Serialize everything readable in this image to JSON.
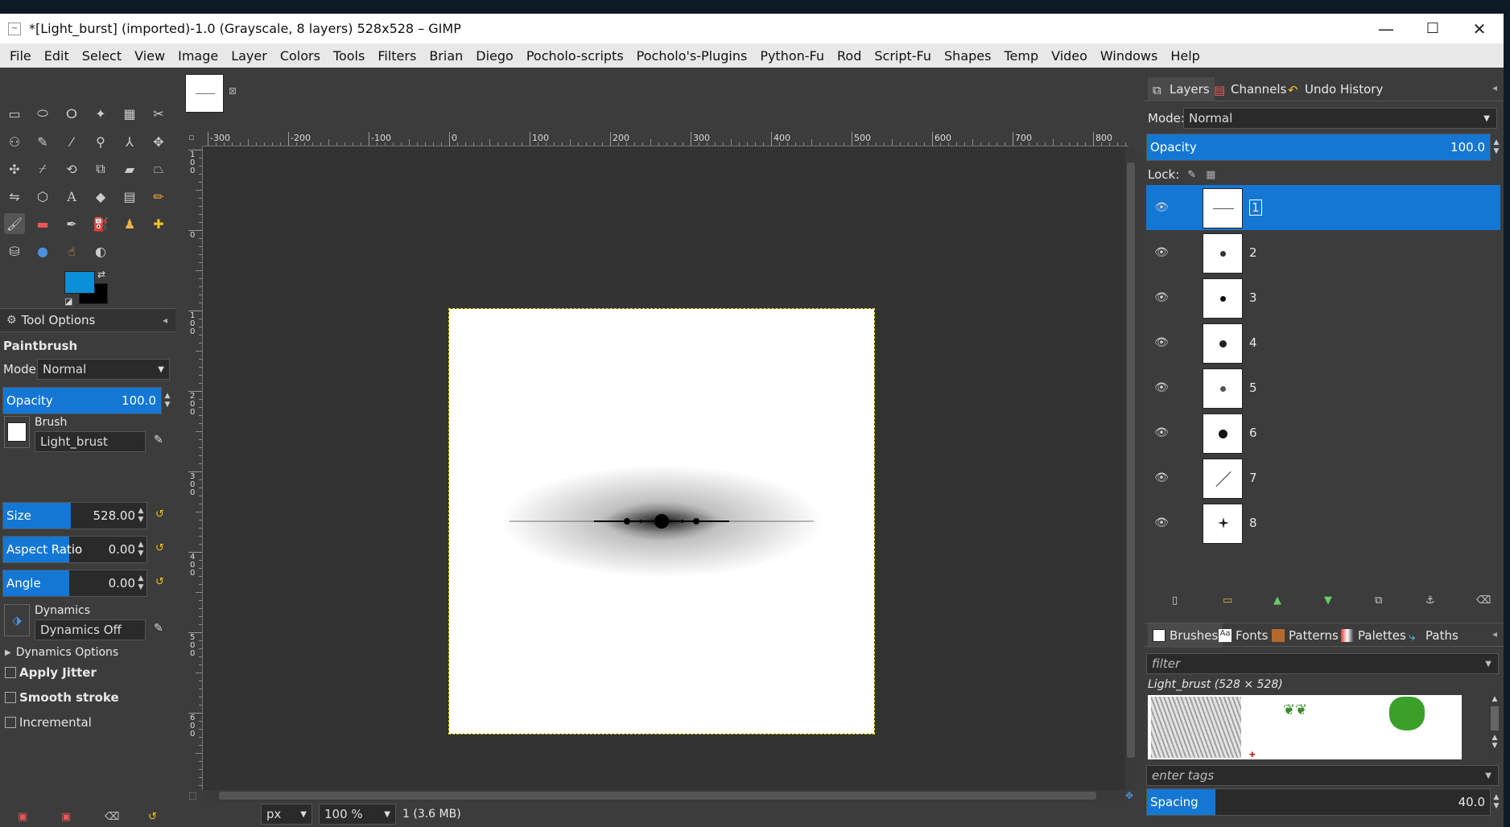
{
  "window": {
    "title": "*[Light_burst] (imported)-1.0 (Grayscale, 8 layers) 528x528 – GIMP",
    "minimize": "—",
    "maximize": "☐",
    "close": "✕"
  },
  "menu": [
    "File",
    "Edit",
    "Select",
    "View",
    "Image",
    "Layer",
    "Colors",
    "Tools",
    "Filters",
    "Brian",
    "Diego",
    "Pocholo-scripts",
    "Pocholo's-Plugins",
    "Python-Fu",
    "Rod",
    "Script-Fu",
    "Shapes",
    "Temp",
    "Video",
    "Windows",
    "Help"
  ],
  "colors": {
    "fg": "#0b8fd6",
    "bg": "#000000",
    "accent": "#1477d4"
  },
  "tool_options": {
    "tab_label": "Tool Options",
    "tool_name": "Paintbrush",
    "mode_label": "Mode:",
    "mode_value": "Normal",
    "opacity_label": "Opacity",
    "opacity_value": "100.0",
    "brush_label": "Brush",
    "brush_value": "Light_brust",
    "size_label": "Size",
    "size_value": "528.00",
    "aspect_label": "Aspect Ratio",
    "aspect_value": "0.00",
    "angle_label": "Angle",
    "angle_value": "0.00",
    "dynamics_label": "Dynamics",
    "dynamics_value": "Dynamics Off",
    "dynamics_options": "Dynamics Options",
    "apply_jitter": "Apply Jitter",
    "smooth_stroke": "Smooth stroke",
    "incremental": "Incremental"
  },
  "ruler": {
    "labels": [
      "-300",
      "-200",
      "-100",
      "0",
      "100",
      "200",
      "300",
      "400",
      "500",
      "600",
      "700",
      "800"
    ]
  },
  "vruler": {
    "labels": [
      "100",
      "0",
      "100",
      "200",
      "300",
      "400",
      "500",
      "600"
    ]
  },
  "status": {
    "unit": "px",
    "zoom": "100 %",
    "info": "1 (3.6 MB)"
  },
  "layers_dock": {
    "tabs": [
      "Layers",
      "Channels",
      "Undo History"
    ],
    "mode_label": "Mode:",
    "mode_value": "Normal",
    "opacity_label": "Opacity",
    "opacity_value": "100.0",
    "lock_label": "Lock:",
    "layers": [
      "1",
      "2",
      "3",
      "4",
      "5",
      "6",
      "7",
      "8"
    ],
    "selected_index": 0
  },
  "brushes_dock": {
    "tabs": [
      "Brushes",
      "Fonts",
      "Patterns",
      "Palettes",
      "Paths"
    ],
    "filter_placeholder": "filter",
    "brush_info": "Light_brust (528 × 528)",
    "tags_placeholder": "enter tags",
    "spacing_label": "Spacing",
    "spacing_value": "40.0",
    "spacing_fraction": 0.2
  }
}
